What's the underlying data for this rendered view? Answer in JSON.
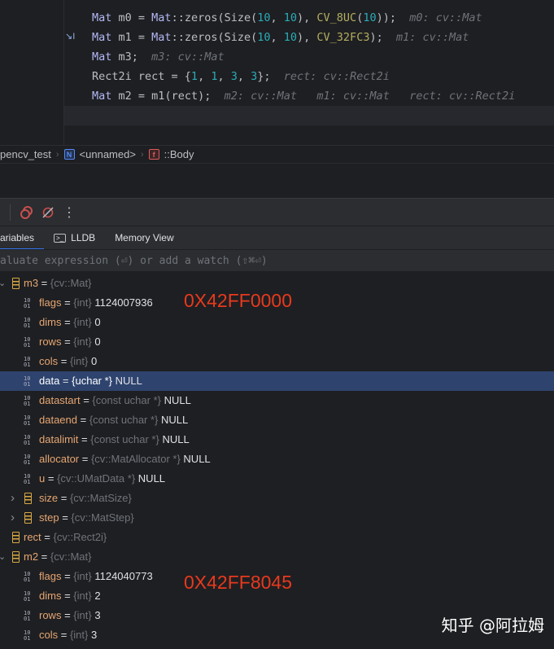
{
  "editor": {
    "lines": [
      [
        [
          "t-type",
          "Mat"
        ],
        [
          "",
          "m0 = "
        ],
        [
          "t-type",
          "Mat"
        ],
        [
          "",
          "::zeros(Size("
        ],
        [
          "t-num",
          "10"
        ],
        [
          "",
          ", "
        ],
        [
          "t-num",
          "10"
        ],
        [
          "",
          "), "
        ],
        [
          "t-macro",
          "CV_8UC"
        ],
        [
          "",
          "("
        ],
        [
          "t-num",
          "10"
        ],
        [
          "",
          "));  "
        ],
        [
          "t-hint",
          "m0: cv::Mat"
        ]
      ],
      [
        [
          "t-type",
          "Mat"
        ],
        [
          "",
          "m1 = "
        ],
        [
          "t-type",
          "Mat"
        ],
        [
          "",
          "::zeros(Size("
        ],
        [
          "t-num",
          "10"
        ],
        [
          "",
          ", "
        ],
        [
          "t-num",
          "10"
        ],
        [
          "",
          "), "
        ],
        [
          "t-macro",
          "CV_32FC3"
        ],
        [
          "",
          ");  "
        ],
        [
          "t-hint",
          "m1: cv::Mat"
        ]
      ],
      [
        [
          "t-type",
          "Mat"
        ],
        [
          "",
          "m3;  "
        ],
        [
          "t-hint",
          "m3: cv::Mat"
        ]
      ],
      [
        [
          "",
          "Rect2i rect = {"
        ],
        [
          "t-num",
          "1"
        ],
        [
          "",
          ", "
        ],
        [
          "t-num",
          "1"
        ],
        [
          "",
          ", "
        ],
        [
          "t-num",
          "3"
        ],
        [
          "",
          ", "
        ],
        [
          "t-num",
          "3"
        ],
        [
          "",
          "};  "
        ],
        [
          "t-hint",
          "rect: cv::Rect2i"
        ]
      ],
      [
        [
          "t-type",
          "Mat"
        ],
        [
          "",
          "m2 = m1"
        ],
        [
          "t-paren",
          "("
        ],
        [
          "",
          "rect"
        ],
        [
          "t-paren",
          ")"
        ],
        [
          "",
          ";  "
        ],
        [
          "t-hint",
          "m2: cv::Mat   m1: cv::Mat   rect: cv::Rect2i"
        ]
      ]
    ]
  },
  "breadcrumb": {
    "project": "pencv_test",
    "namespace": "<unnamed>",
    "ns_badge": "N",
    "function": "::Body",
    "fn_badge": "f"
  },
  "tabs": {
    "variables": "ariables",
    "lldb": "LLDB",
    "memory": "Memory View"
  },
  "eval": {
    "placeholder": "aluate expression (⏎) or add a watch (⇧⌘⏎)"
  },
  "tree": [
    {
      "level": 0,
      "expand": "open",
      "icon": "object",
      "name": "m3",
      "type": "{cv::Mat}",
      "value": ""
    },
    {
      "level": 1,
      "icon": "binary",
      "name": "flags",
      "type": "{int}",
      "value": "1124007936"
    },
    {
      "level": 1,
      "icon": "binary",
      "name": "dims",
      "type": "{int}",
      "value": "0"
    },
    {
      "level": 1,
      "icon": "binary",
      "name": "rows",
      "type": "{int}",
      "value": "0"
    },
    {
      "level": 1,
      "icon": "binary",
      "name": "cols",
      "type": "{int}",
      "value": "0"
    },
    {
      "level": 1,
      "icon": "binary",
      "name": "data",
      "type": "{uchar *}",
      "value": "NULL",
      "selected": true
    },
    {
      "level": 1,
      "icon": "binary",
      "name": "datastart",
      "type": "{const uchar *}",
      "value": "NULL"
    },
    {
      "level": 1,
      "icon": "binary",
      "name": "dataend",
      "type": "{const uchar *}",
      "value": "NULL"
    },
    {
      "level": 1,
      "icon": "binary",
      "name": "datalimit",
      "type": "{const uchar *}",
      "value": "NULL"
    },
    {
      "level": 1,
      "icon": "binary",
      "name": "allocator",
      "type": "{cv::MatAllocator *}",
      "value": "NULL"
    },
    {
      "level": 1,
      "icon": "binary",
      "name": "u",
      "type": "{cv::UMatData *}",
      "value": "NULL"
    },
    {
      "level": 1,
      "expand": "closed",
      "icon": "object",
      "name": "size",
      "type": "{cv::MatSize}",
      "value": ""
    },
    {
      "level": 1,
      "expand": "closed",
      "icon": "object",
      "name": "step",
      "type": "{cv::MatStep}",
      "value": ""
    },
    {
      "level": 0,
      "icon": "object",
      "name": "rect",
      "type": "{cv::Rect2i}",
      "value": ""
    },
    {
      "level": 0,
      "expand": "open",
      "icon": "object",
      "name": "m2",
      "type": "{cv::Mat}",
      "value": ""
    },
    {
      "level": 1,
      "icon": "binary",
      "name": "flags",
      "type": "{int}",
      "value": "1124040773"
    },
    {
      "level": 1,
      "icon": "binary",
      "name": "dims",
      "type": "{int}",
      "value": "2"
    },
    {
      "level": 1,
      "icon": "binary",
      "name": "rows",
      "type": "{int}",
      "value": "3"
    },
    {
      "level": 1,
      "icon": "binary",
      "name": "cols",
      "type": "{int}",
      "value": "3"
    }
  ],
  "annotations": {
    "m3_flags_hex": "0X42FF0000",
    "m2_flags_hex": "0X42FF8045"
  },
  "watermark": "知乎 @阿拉姆"
}
